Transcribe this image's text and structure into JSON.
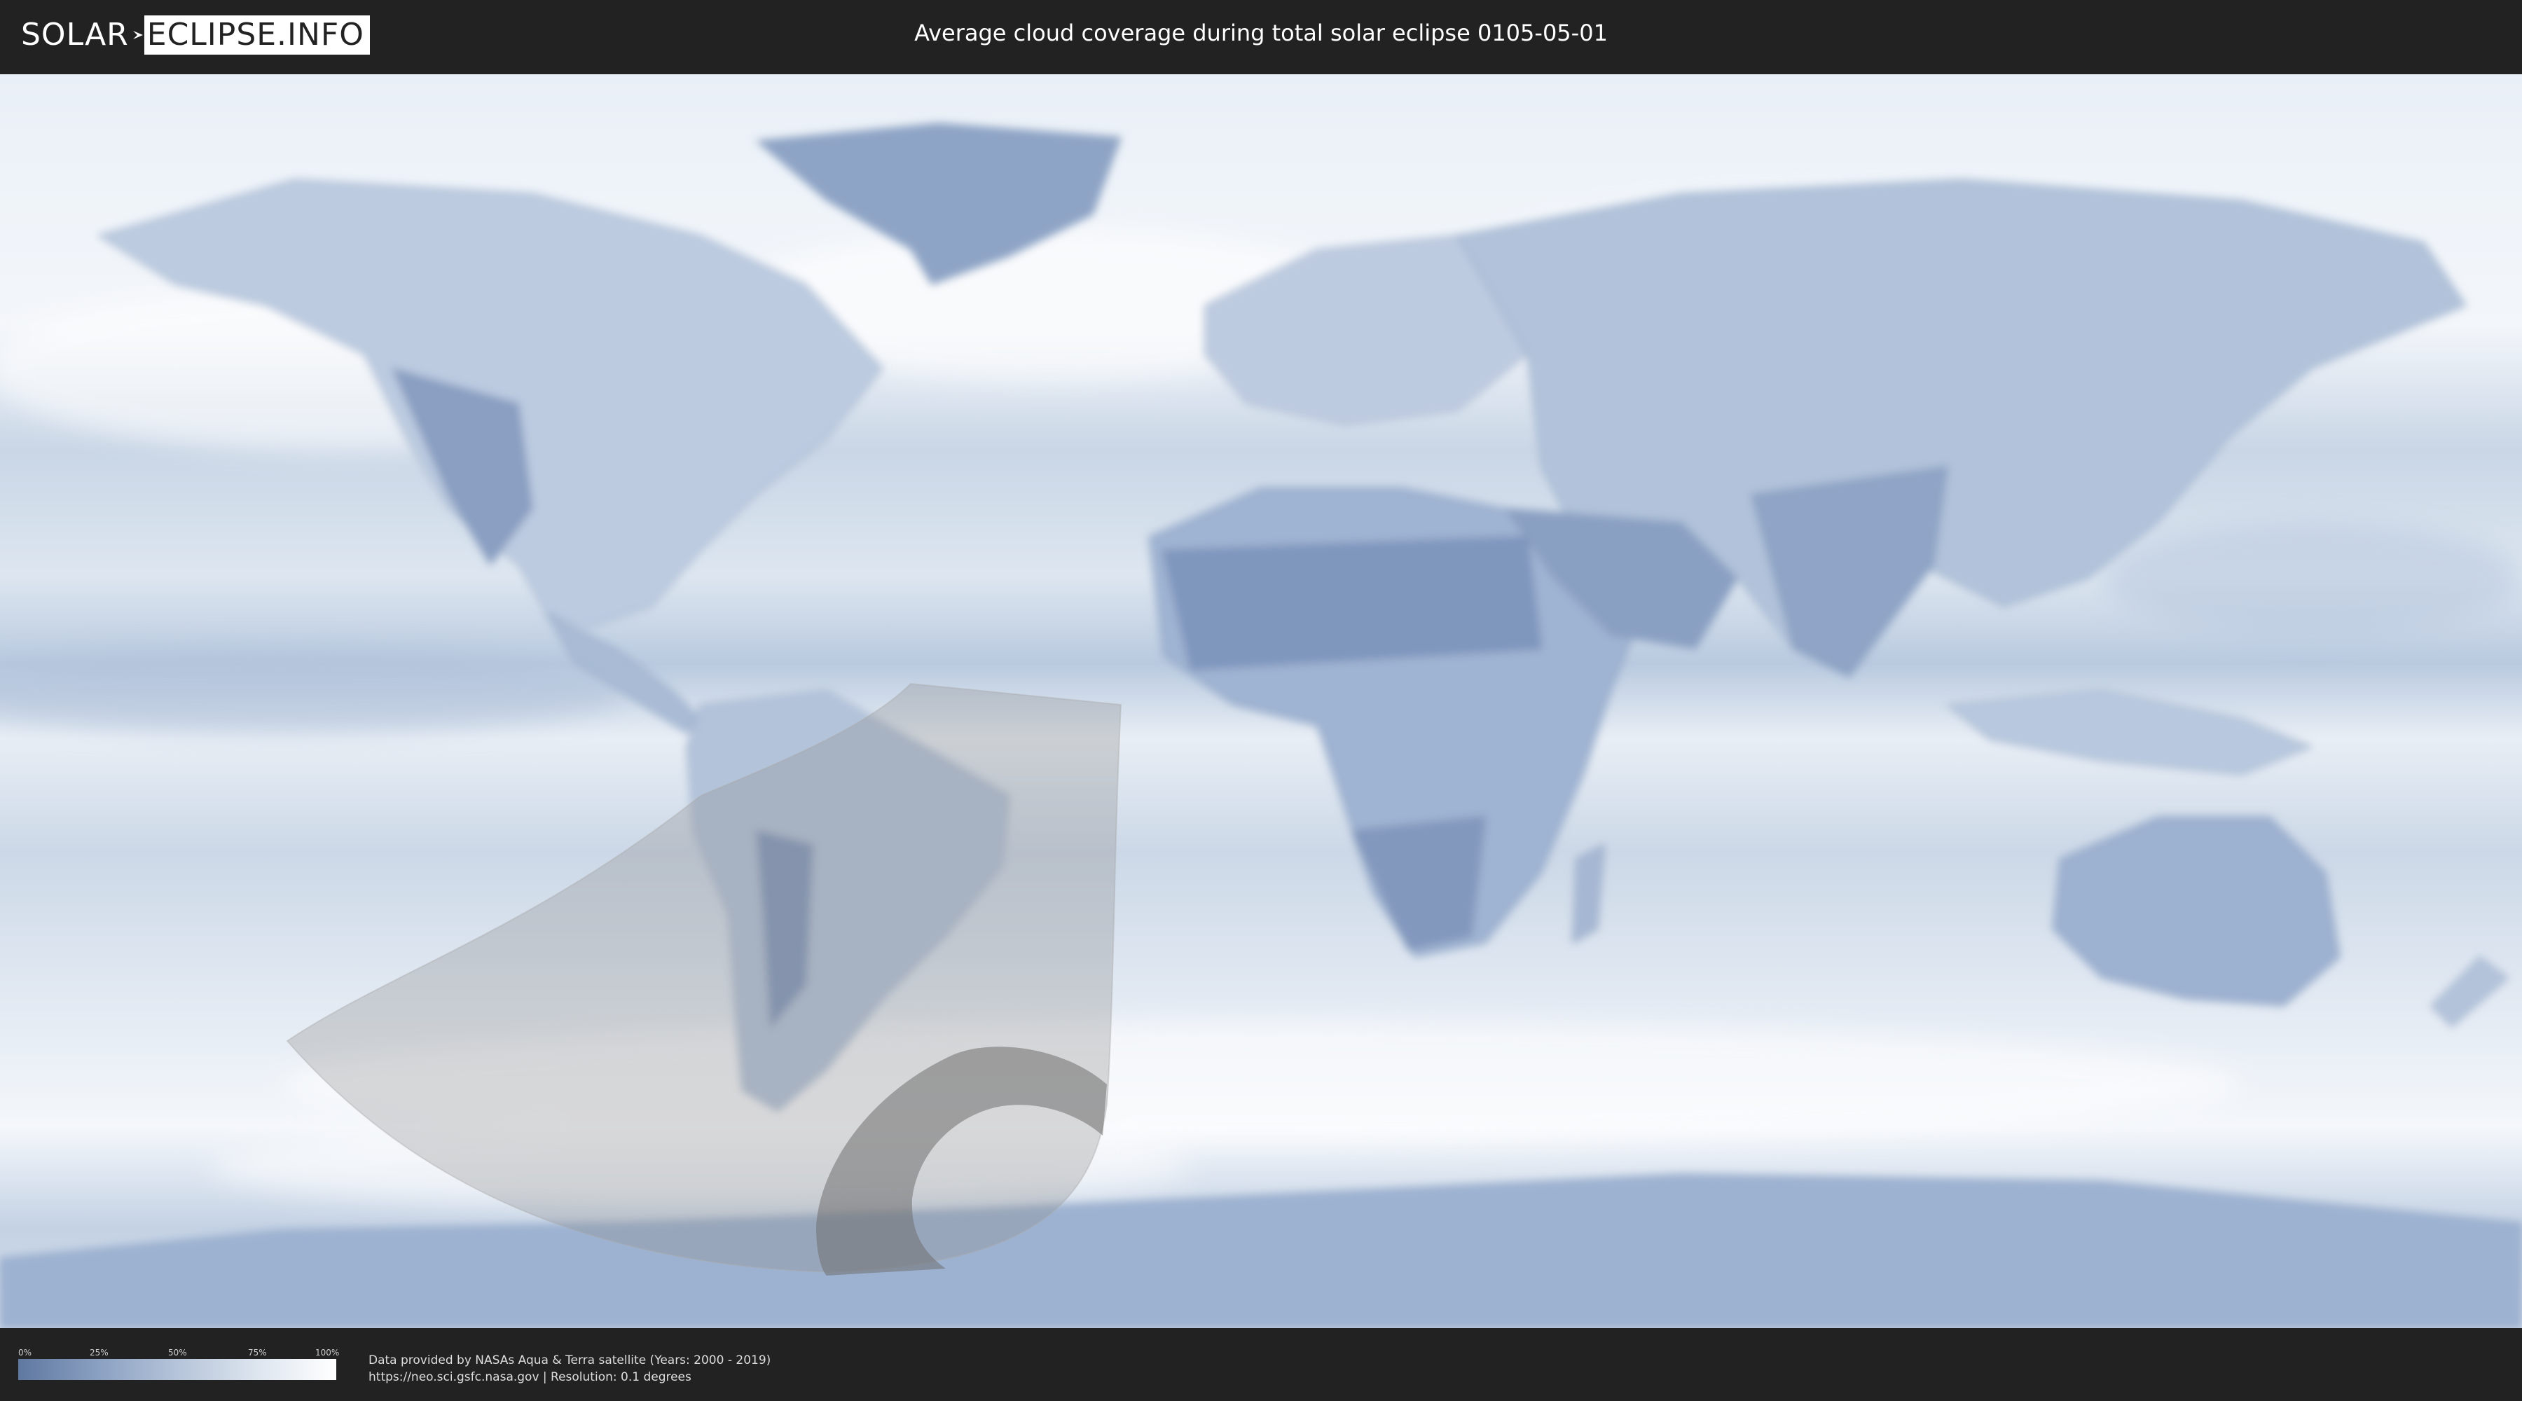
{
  "header": {
    "logo_solar": "SOLAR",
    "logo_eclipse": "ECLIPSE.INFO",
    "title": "Average cloud coverage during total solar eclipse 0105-05-01"
  },
  "map": {
    "background_color": "#dfe8f2",
    "cloud_dark_color": "#6f88b0",
    "shadow_color": "#8f8f8f",
    "umbra_color": "#707070"
  },
  "footer": {
    "legend": {
      "ticks": [
        "0%",
        "25%",
        "50%",
        "75%",
        "100%"
      ],
      "gradient_start": "#5f78a0",
      "gradient_end": "#ffffff"
    },
    "credits_line1": "Data provided by NASAs Aqua & Terra satellite (Years: 2000 - 2019)",
    "credits_line2": "https://neo.sci.gsfc.nasa.gov | Resolution: 0.1 degrees"
  }
}
